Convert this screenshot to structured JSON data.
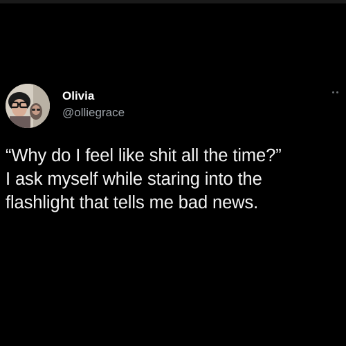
{
  "tweet": {
    "author": {
      "display_name": "Olivia",
      "handle": "@olliegrace",
      "avatar_icon": "profile-photo"
    },
    "more_icon": "ellipsis-icon",
    "text_lines": [
      "“Why do I feel like shit all the time?”",
      "I ask myself while staring into the",
      "flashlight that tells me bad news."
    ]
  },
  "colors": {
    "background": "#000000",
    "primary_text": "#ffffff",
    "secondary_text": "#9aa0a6"
  }
}
